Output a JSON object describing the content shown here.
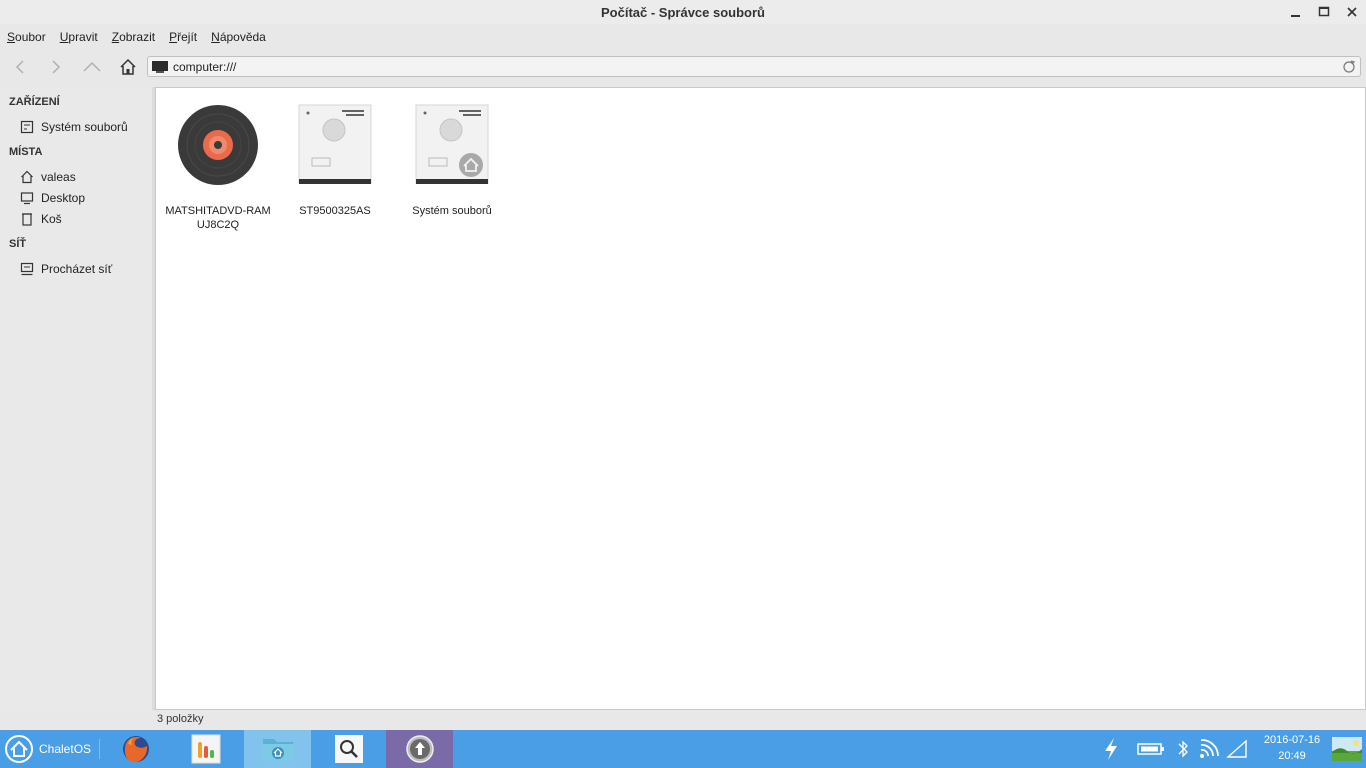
{
  "window": {
    "title": "Počítač - Správce souborů"
  },
  "menu": [
    "Soubor",
    "Upravit",
    "Zobrazit",
    "Přejít",
    "Nápověda"
  ],
  "location": {
    "value": "computer:///"
  },
  "sidebar": {
    "sections": [
      {
        "heading": "ZAŘÍZENÍ",
        "items": [
          {
            "label": "Systém souborů",
            "icon": "drive-icon"
          }
        ]
      },
      {
        "heading": "MÍSTA",
        "items": [
          {
            "label": "valeas",
            "icon": "home-icon"
          },
          {
            "label": "Desktop",
            "icon": "desktop-icon"
          },
          {
            "label": "Koš",
            "icon": "trash-icon"
          }
        ]
      },
      {
        "heading": "SÍŤ",
        "items": [
          {
            "label": "Procházet síť",
            "icon": "network-icon"
          }
        ]
      }
    ]
  },
  "files": [
    {
      "name": "MATSHITADVD-RAM UJ8C2Q",
      "icon": "optical-disc-icon"
    },
    {
      "name": "ST9500325AS",
      "icon": "hard-drive-icon"
    },
    {
      "name": "Systém souborů",
      "icon": "root-filesystem-icon"
    }
  ],
  "status": {
    "text": "3 položky"
  },
  "taskbar": {
    "start_label": "ChaletOS",
    "apps": [
      "firefox-icon",
      "system-monitor-icon",
      "file-manager-icon",
      "search-icon",
      "update-icon"
    ],
    "date": "2016-07-16",
    "time": "20:49"
  },
  "colors": {
    "taskbar": "#4a9ee6",
    "active_task": "#82c3ee",
    "disc_accent": "#ec6a4c"
  }
}
